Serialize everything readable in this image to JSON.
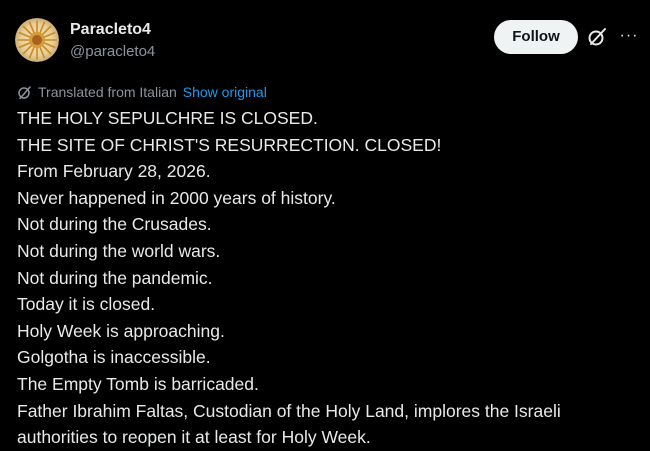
{
  "user": {
    "display_name": "Paracleto4",
    "handle": "@paracleto4"
  },
  "actions": {
    "follow_label": "Follow",
    "grok_icon": "grok-slash-circle-icon",
    "more_icon": "more-horizontal-icon",
    "more_label": "···"
  },
  "translation": {
    "label": "Translated from Italian",
    "show_original": "Show original",
    "icon": "translate-circle-icon"
  },
  "tweet": {
    "lines": [
      "THE HOLY SEPULCHRE IS CLOSED.",
      "THE SITE OF CHRIST'S RESURRECTION. CLOSED!",
      "From February 28, 2026.",
      "Never happened in 2000 years of history.",
      "Not during the Crusades.",
      "Not during the world wars.",
      "Not during the pandemic.",
      "Today it is closed.",
      "Holy Week is approaching.",
      "Golgotha is inaccessible.",
      "The Empty Tomb is barricaded.",
      "Father Ibrahim Faltas, Custodian of the Holy Land, implores the Israeli",
      "authorities to reopen it at least for Holy Week."
    ]
  },
  "colors": {
    "background": "#000000",
    "text": "#e7e9ea",
    "muted": "#8b949e",
    "link": "#1d9bf0",
    "follow_bg": "#eff3f4"
  }
}
